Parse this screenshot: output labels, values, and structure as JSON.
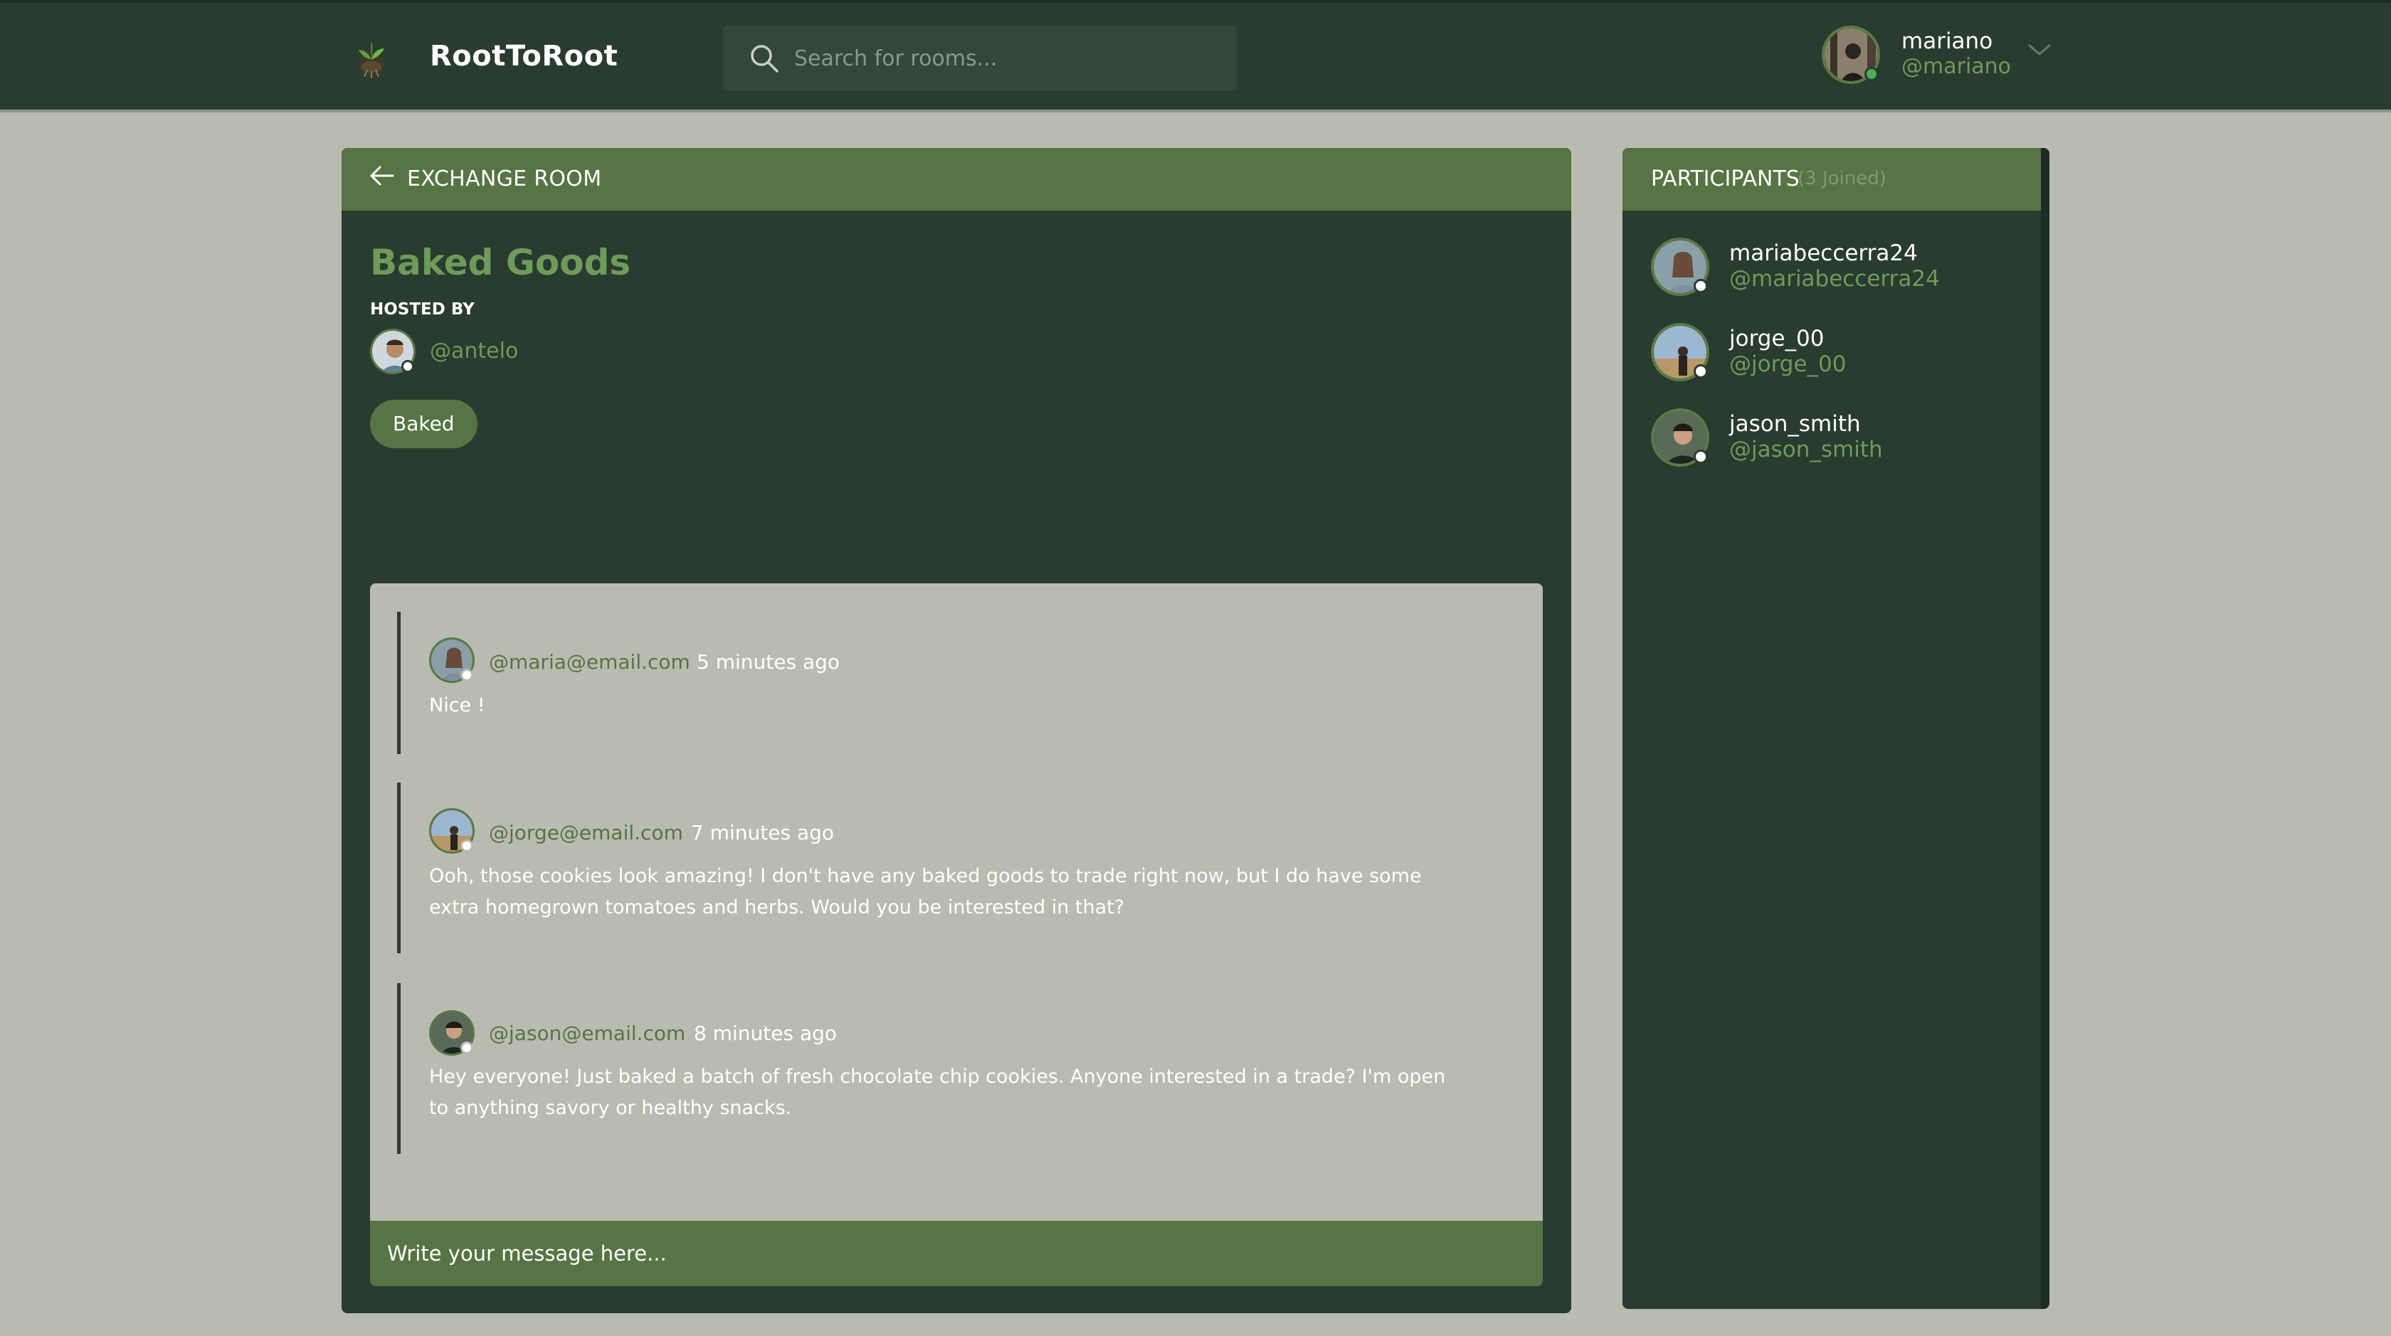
{
  "header": {
    "brand": "RootToRoot",
    "logo_icon": "seedling-logo-icon",
    "search_placeholder": "Search for rooms...",
    "user": {
      "name": "mariano",
      "handle": "@mariano",
      "status": "online"
    }
  },
  "room": {
    "section_label": "EXCHANGE ROOM",
    "title": "Baked Goods",
    "hosted_by_label": "HOSTED BY",
    "host_handle": "@antelo",
    "tag": "Baked",
    "messages": [
      {
        "user": "@maria@email.com",
        "time": "5 minutes ago",
        "body": "Nice !"
      },
      {
        "user": "@jorge@email.com",
        "time": "7 minutes ago",
        "body": "Ooh, those cookies look amazing! I don't have any baked goods to trade right now, but I do have some extra homegrown tomatoes and herbs. Would you be interested in that?"
      },
      {
        "user": "@jason@email.com",
        "time": "8 minutes ago",
        "body": "Hey everyone! Just baked a batch of fresh chocolate chip cookies. Anyone interested in a trade? I'm open to anything savory or healthy snacks."
      }
    ],
    "composer_placeholder": "Write your message here..."
  },
  "participants": {
    "title": "PARTICIPANTS",
    "count_label": "(3 Joined)",
    "items": [
      {
        "name": "mariabeccerra24",
        "handle": "@mariabeccerra24"
      },
      {
        "name": "jorge_00",
        "handle": "@jorge_00"
      },
      {
        "name": "jason_smith",
        "handle": "@jason_smith"
      }
    ]
  },
  "colors": {
    "header_bg": "#2a3b2f",
    "panel_bg": "#2a3b2f",
    "accent_green": "#577444",
    "handle_green": "#6e9a5a",
    "page_bg": "#b9bbb0",
    "online": "#4caf50"
  }
}
